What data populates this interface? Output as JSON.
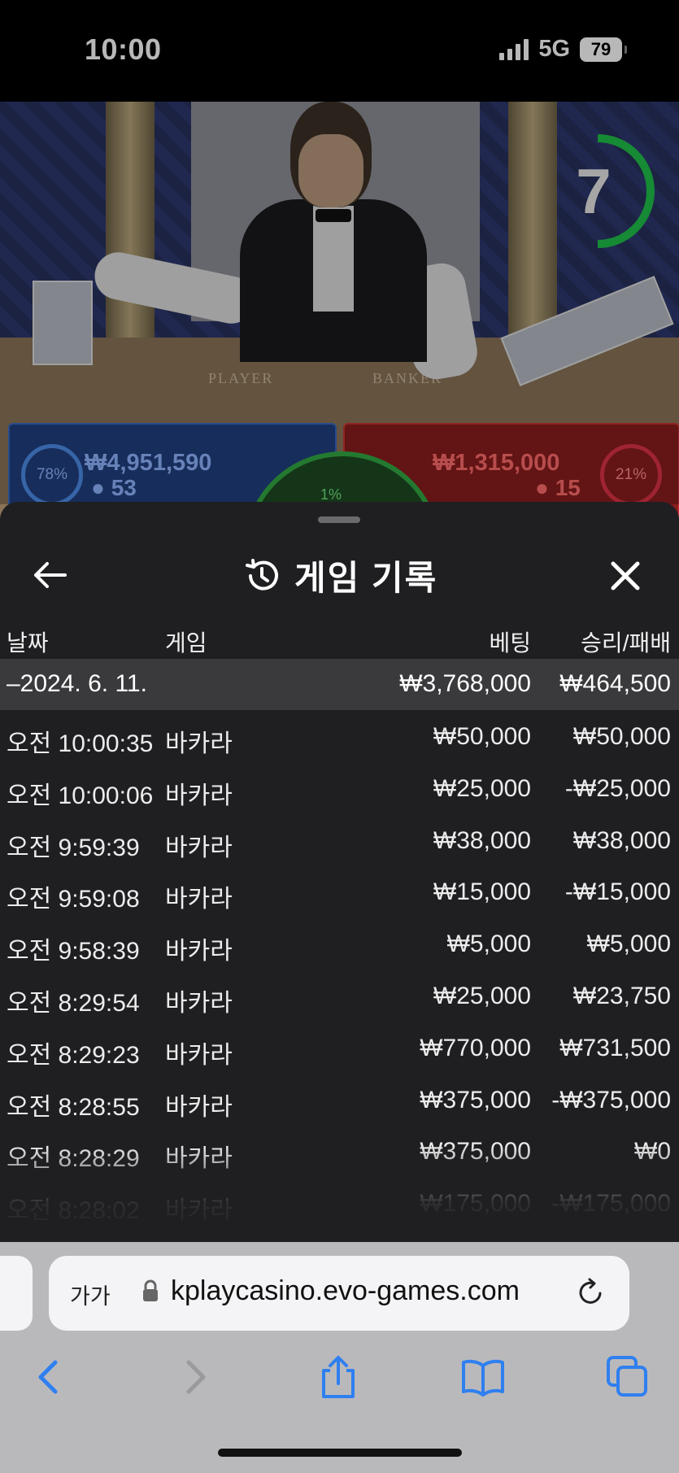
{
  "status_bar": {
    "time": "10:00",
    "network": "5G",
    "battery": "79"
  },
  "game_view": {
    "timer": "7",
    "felt_labels": [
      "PLAYER",
      "BANKER"
    ],
    "player": {
      "percent": "78%",
      "amount": "₩4,951,590",
      "count": "53"
    },
    "banker": {
      "percent": "21%",
      "amount": "₩1,315,000",
      "count": "15"
    },
    "tie": {
      "percent": "1%"
    }
  },
  "sheet": {
    "title": "게임 기록",
    "columns": {
      "date": "날짜",
      "game": "게임",
      "bet": "베팅",
      "result": "승리/패배"
    },
    "date_group": {
      "date": "–2024. 6. 11.",
      "bet_total": "₩3,768,000",
      "result_total": "₩464,500"
    },
    "rows": [
      {
        "time": "오전 10:00:35",
        "game": "바카라",
        "bet": "₩50,000",
        "result": "₩50,000"
      },
      {
        "time": "오전 10:00:06",
        "game": "바카라",
        "bet": "₩25,000",
        "result": "-₩25,000"
      },
      {
        "time": "오전 9:59:39",
        "game": "바카라",
        "bet": "₩38,000",
        "result": "₩38,000"
      },
      {
        "time": "오전 9:59:08",
        "game": "바카라",
        "bet": "₩15,000",
        "result": "-₩15,000"
      },
      {
        "time": "오전 9:58:39",
        "game": "바카라",
        "bet": "₩5,000",
        "result": "₩5,000"
      },
      {
        "time": "오전 8:29:54",
        "game": "바카라",
        "bet": "₩25,000",
        "result": "₩23,750"
      },
      {
        "time": "오전 8:29:23",
        "game": "바카라",
        "bet": "₩770,000",
        "result": "₩731,500"
      },
      {
        "time": "오전 8:28:55",
        "game": "바카라",
        "bet": "₩375,000",
        "result": "-₩375,000"
      },
      {
        "time": "오전 8:28:29",
        "game": "바카라",
        "bet": "₩375,000",
        "result": "₩0"
      },
      {
        "time": "오전 8:28:02",
        "game": "바카라",
        "bet": "₩175,000",
        "result": "-₩175,000"
      }
    ]
  },
  "browser": {
    "text_size_label": "가가",
    "url": "kplaycasino.evo-games.com"
  },
  "colors": {
    "sheet_bg": "#1f1f22",
    "date_row_bg": "#3a3a3c",
    "player_blue": "#203f7e",
    "banker_red": "#8a1d1d",
    "timer_green": "#1fbf4a",
    "browser_accent": "#2f7ff0"
  }
}
